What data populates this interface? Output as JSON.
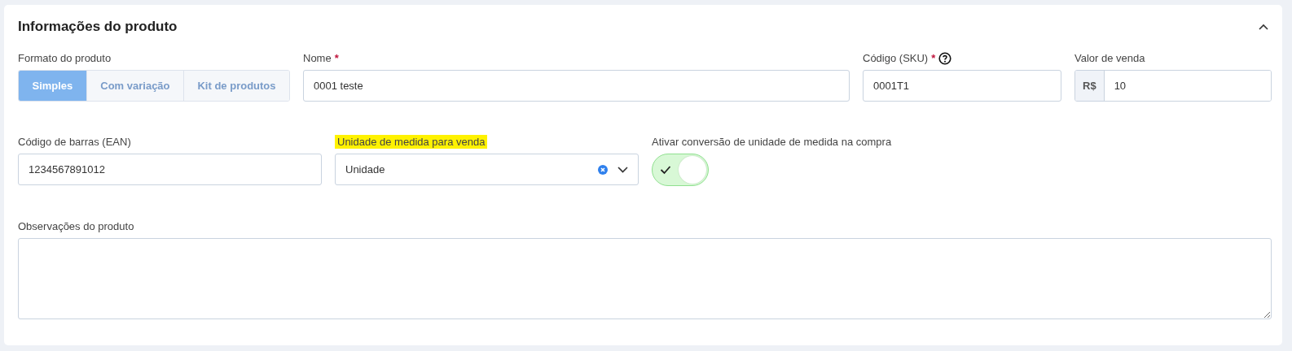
{
  "section": {
    "title": "Informações do produto",
    "expanded": true
  },
  "format": {
    "label": "Formato do produto",
    "options": [
      {
        "label": "Simples",
        "selected": true
      },
      {
        "label": "Com variação",
        "selected": false
      },
      {
        "label": "Kit de produtos",
        "selected": false
      }
    ]
  },
  "name": {
    "label": "Nome",
    "required_mark": "*",
    "value": "0001 teste"
  },
  "sku": {
    "label": "Código (SKU)",
    "required_mark": "*",
    "value": "0001T1"
  },
  "price": {
    "label": "Valor de venda",
    "prefix": "R$",
    "value": "10"
  },
  "barcode": {
    "label": "Código de barras (EAN)",
    "value": "1234567891012"
  },
  "unit": {
    "label": "Unidade de medida para venda",
    "highlighted": true,
    "value": "Unidade"
  },
  "conversion": {
    "label": "Ativar conversão de unidade de medida na compra",
    "on": true
  },
  "notes": {
    "label": "Observações do produto"
  }
}
